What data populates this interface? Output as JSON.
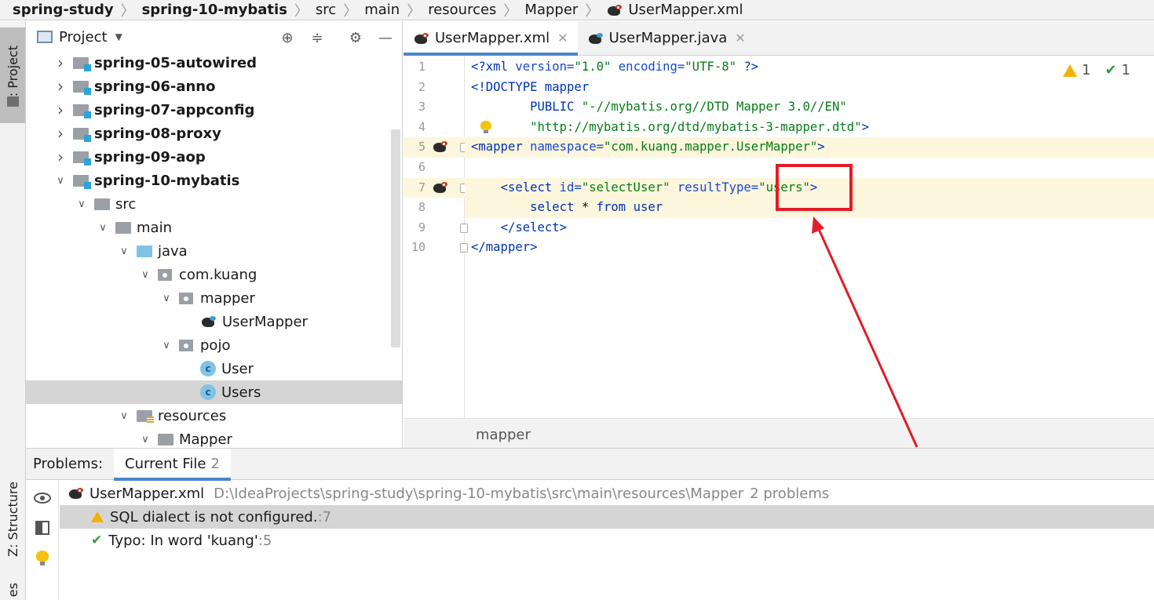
{
  "breadcrumb": {
    "items": [
      "spring-study",
      "spring-10-mybatis",
      "src",
      "main",
      "resources",
      "Mapper",
      "UserMapper.xml"
    ]
  },
  "left_strip": {
    "project_tab": "1: Project",
    "structure_tab": "Z: Structure",
    "favorites_tab": "es"
  },
  "project_panel": {
    "title": "Project",
    "tree": [
      {
        "label": "spring-05-autowired",
        "kind": "module",
        "expanded": false,
        "level": 0
      },
      {
        "label": "spring-06-anno",
        "kind": "module",
        "expanded": false,
        "level": 0
      },
      {
        "label": "spring-07-appconfig",
        "kind": "module",
        "expanded": false,
        "level": 0
      },
      {
        "label": "spring-08-proxy",
        "kind": "module",
        "expanded": false,
        "level": 0
      },
      {
        "label": "spring-09-aop",
        "kind": "module",
        "expanded": false,
        "level": 0
      },
      {
        "label": "spring-10-mybatis",
        "kind": "module",
        "expanded": true,
        "level": 0
      },
      {
        "label": "src",
        "kind": "folder",
        "expanded": true,
        "level": 1
      },
      {
        "label": "main",
        "kind": "folder",
        "expanded": true,
        "level": 2
      },
      {
        "label": "java",
        "kind": "java",
        "expanded": true,
        "level": 3
      },
      {
        "label": "com.kuang",
        "kind": "package",
        "expanded": true,
        "level": 4
      },
      {
        "label": "mapper",
        "kind": "package",
        "expanded": true,
        "level": 5
      },
      {
        "label": "UserMapper",
        "kind": "mapper",
        "level": 6
      },
      {
        "label": "pojo",
        "kind": "package",
        "expanded": true,
        "level": 5
      },
      {
        "label": "User",
        "kind": "class",
        "level": 6
      },
      {
        "label": "Users",
        "kind": "class",
        "level": 6,
        "selected": true
      },
      {
        "label": "resources",
        "kind": "res",
        "expanded": true,
        "level": 3
      },
      {
        "label": "Mapper",
        "kind": "folder",
        "expanded": true,
        "level": 4
      }
    ]
  },
  "editor": {
    "tabs": [
      {
        "label": "UserMapper.xml",
        "active": true
      },
      {
        "label": "UserMapper.java",
        "active": false
      }
    ],
    "inspections": {
      "warnings": "1",
      "typos": "1"
    },
    "lines": [
      {
        "n": "1",
        "tokens": [
          [
            "t-tag",
            "<?xml "
          ],
          [
            "t-attr",
            "version="
          ],
          [
            "t-val",
            "\"1.0\" "
          ],
          [
            "t-attr",
            "encoding="
          ],
          [
            "t-val",
            "\"UTF-8\" "
          ],
          [
            "t-tag",
            "?>"
          ]
        ]
      },
      {
        "n": "2",
        "tokens": [
          [
            "t-tag",
            "<!DOCTYPE mapper"
          ]
        ]
      },
      {
        "n": "3",
        "tokens": [
          [
            "t-plain",
            "        "
          ],
          [
            "t-tag",
            "PUBLIC "
          ],
          [
            "t-val",
            "\"-//mybatis.org//DTD Mapper 3.0//EN\""
          ]
        ]
      },
      {
        "n": "4",
        "tokens": [
          [
            "t-plain",
            "        "
          ],
          [
            "t-val",
            "\"http://mybatis.org/dtd/mybatis-3-mapper.dtd\""
          ],
          [
            "t-tag",
            ">"
          ]
        ]
      },
      {
        "n": "5",
        "tokens": [
          [
            "t-tag",
            "<mapper "
          ],
          [
            "t-attr",
            "namespace="
          ],
          [
            "t-val",
            "\"com.kuang.mapper.UserMapper\""
          ],
          [
            "t-tag",
            ">"
          ]
        ]
      },
      {
        "n": "6",
        "tokens": []
      },
      {
        "n": "7",
        "tokens": [
          [
            "t-plain",
            "    "
          ],
          [
            "t-tag",
            "<select "
          ],
          [
            "t-attr",
            "id="
          ],
          [
            "t-val",
            "\"selectUser\" "
          ],
          [
            "t-attr",
            "resultType="
          ],
          [
            "t-val",
            "\"users\""
          ],
          [
            "t-tag",
            ">"
          ]
        ]
      },
      {
        "n": "8",
        "tokens": [
          [
            "t-plain",
            "        "
          ],
          [
            "t-kw",
            "select "
          ],
          [
            "t-plain",
            "* "
          ],
          [
            "t-kw",
            "from "
          ],
          [
            "t-kw",
            "user"
          ]
        ]
      },
      {
        "n": "9",
        "tokens": [
          [
            "t-plain",
            "    "
          ],
          [
            "t-tag",
            "</select>"
          ]
        ]
      },
      {
        "n": "10",
        "tokens": [
          [
            "t-tag",
            "</mapper>"
          ]
        ]
      }
    ],
    "footer_breadcrumb": "mapper"
  },
  "problems": {
    "label": "Problems:",
    "tab": "Current File",
    "tab_count": "2",
    "file": "UserMapper.xml",
    "path": "D:\\IdeaProjects\\spring-study\\spring-10-mybatis\\src\\main\\resources\\Mapper",
    "count": "2 problems",
    "items": [
      {
        "text": "SQL dialect is not configured.",
        "line": ":7"
      },
      {
        "text": "Typo: In word 'kuang'",
        "line": ":5"
      }
    ]
  },
  "colors": {
    "accent": "#4a86c8",
    "annotation": "#e11d26",
    "selection": "#d5d5d5",
    "current_line": "#fcf6dc"
  }
}
